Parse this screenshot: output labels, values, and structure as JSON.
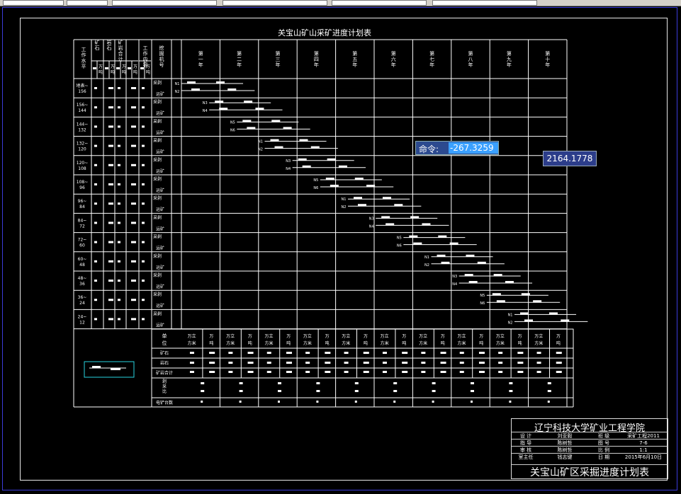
{
  "command": {
    "label": "命令:",
    "value": "-267.3259"
  },
  "coordinate_readout": "2164.1778",
  "table": {
    "title": "关宝山矿山采矿进度计划表",
    "header_cols": [
      "工作水平",
      "矿石",
      "岩石",
      "矿岩合计",
      "工作内容",
      "挖掘机号"
    ],
    "sub_units": [
      "万吨"
    ],
    "years": [
      "第一年",
      "第二年",
      "第三年",
      "第四年",
      "第五年",
      "第六年",
      "第七年",
      "第八年",
      "第九年",
      "第十年"
    ],
    "levels": [
      "地表~156",
      "156~144",
      "144~132",
      "132~120",
      "120~108",
      "108~96",
      "96~84",
      "84~72",
      "72~60",
      "60~48",
      "48~36",
      "36~24",
      "24~12"
    ],
    "work_top": "采剥",
    "work_bottom": "运矿",
    "summary": {
      "unit_label": "单位",
      "unit_a": "万立方米",
      "unit_b": "万吨",
      "rows": [
        "矿石",
        "岩石",
        "矿岩合计",
        "剥采比",
        "电铲台数"
      ]
    },
    "shovel_labels": [
      "N1",
      "N2",
      "N3",
      "N4",
      "N5",
      "N6"
    ]
  },
  "title_block": {
    "school": "辽宁科技大学矿业工程学院",
    "rows": [
      [
        "设 计",
        "刘亚毅",
        "班 级",
        "采矿工程2011"
      ],
      [
        "指 导",
        "陈树哲",
        "图 号",
        "7-6"
      ],
      [
        "审 核",
        "陈树哲",
        "比 例",
        "1:1"
      ],
      [
        "室主任",
        "钱志键",
        "日 期",
        "2015年6月10日"
      ]
    ],
    "drawing_title": "关宝山矿区采掘进度计划表"
  }
}
